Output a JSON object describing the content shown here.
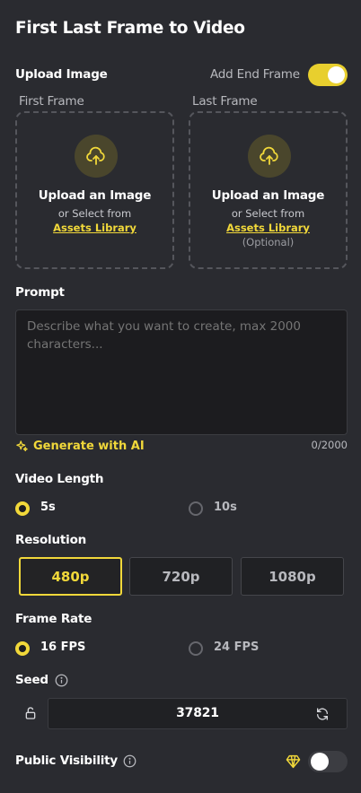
{
  "title": "First Last Frame to Video",
  "upload": {
    "section_label": "Upload Image",
    "end_frame_label": "Add End Frame",
    "end_frame_enabled": true,
    "first": {
      "label": "First Frame",
      "upload_title": "Upload an Image",
      "or_select": "or Select from",
      "library_link": "Assets Library"
    },
    "last": {
      "label": "Last Frame",
      "upload_title": "Upload an Image",
      "or_select": "or Select from",
      "library_link": "Assets Library",
      "optional": "(Optional)"
    }
  },
  "prompt": {
    "label": "Prompt",
    "placeholder": "Describe what you want to create, max 2000 characters...",
    "generate_label": "Generate with AI",
    "counter": "0/2000"
  },
  "video_length": {
    "label": "Video Length",
    "options": [
      {
        "label": "5s",
        "selected": true
      },
      {
        "label": "10s",
        "selected": false
      }
    ]
  },
  "resolution": {
    "label": "Resolution",
    "options": [
      {
        "label": "480p",
        "selected": true
      },
      {
        "label": "720p",
        "selected": false
      },
      {
        "label": "1080p",
        "selected": false
      }
    ]
  },
  "frame_rate": {
    "label": "Frame Rate",
    "options": [
      {
        "label": "16 FPS",
        "selected": true
      },
      {
        "label": "24 FPS",
        "selected": false
      }
    ]
  },
  "seed": {
    "label": "Seed",
    "value": "37821"
  },
  "visibility": {
    "label": "Public Visibility",
    "enabled": false
  },
  "colors": {
    "accent": "#f1d83a",
    "background": "#2a2b30"
  },
  "icons": [
    "cloud-upload-icon",
    "sparkle-icon",
    "info-icon",
    "lock-icon",
    "refresh-icon",
    "diamond-icon"
  ]
}
